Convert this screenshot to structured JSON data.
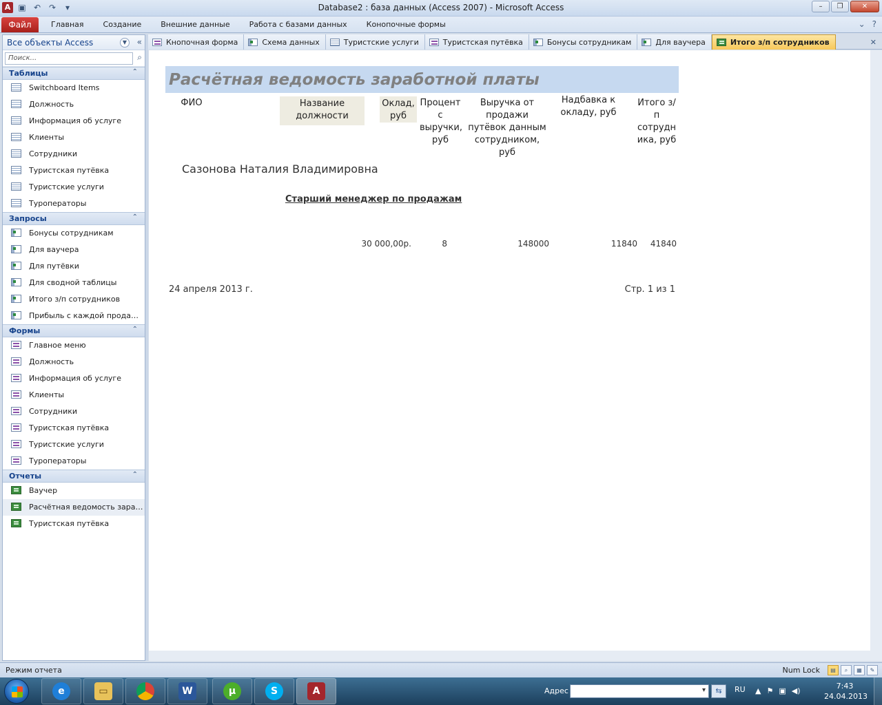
{
  "window": {
    "title": "Database2 : база данных (Access 2007)  -  Microsoft Access",
    "app_icon": "A"
  },
  "ribbon": {
    "file_tab": "Файл",
    "tabs": [
      "Главная",
      "Создание",
      "Внешние данные",
      "Работа с базами данных",
      "Конопочные формы"
    ]
  },
  "nav": {
    "title": "Все объекты Access",
    "search_placeholder": "Поиск...",
    "groups": [
      {
        "title": "Таблицы",
        "items": [
          "Switchboard Items",
          "Должность",
          "Информация об услуге",
          "Клиенты",
          "Сотрудники",
          "Туристская путёвка",
          "Туристские услуги",
          "Туроператоры"
        ]
      },
      {
        "title": "Запросы",
        "items": [
          "Бонусы сотрудникам",
          "Для ваучера",
          "Для путёвки",
          "Для сводной таблицы",
          "Итого з/п сотрудников",
          "Прибыль с каждой проданн..."
        ]
      },
      {
        "title": "Формы",
        "items": [
          "Главное меню",
          "Должность",
          "Информация об услуге",
          "Клиенты",
          "Сотрудники",
          "Туристская путёвка",
          "Туристские услуги",
          "Туроператоры"
        ]
      },
      {
        "title": "Отчеты",
        "items": [
          "Ваучер",
          "Расчётная ведомость зараб...",
          "Туристская путёвка"
        ]
      }
    ]
  },
  "doc_tabs": [
    "Кнопочная форма",
    "Схема данных",
    "Туристские услуги",
    "Туристская путёвка",
    "Бонусы сотрудникам",
    "Для ваучера",
    "Итого з/п сотрудников"
  ],
  "report": {
    "title": "Расчётная ведомость заработной платы",
    "headers": {
      "fio": "ФИО",
      "position": "Название должности",
      "salary": "Оклад, руб",
      "percent": "Процент с выручки, руб",
      "revenue": "Выручка от продажи путёвок данным сотрудником, руб",
      "bonus": "Надбавка к окладу, руб",
      "total": "Итого з/п сотрудн ика, руб"
    },
    "employee_name": "Сазонова Наталия Владимировна",
    "position_name": "Старший менеджер по продажам",
    "values": {
      "salary": "30 000,00р.",
      "percent": "8",
      "revenue": "148000",
      "bonus": "11840",
      "total": "41840"
    },
    "footer_date": "24 апреля 2013 г.",
    "footer_page": "Стр. 1 из 1"
  },
  "status": {
    "mode": "Режим отчета",
    "numlock": "Num Lock"
  },
  "taskbar": {
    "address_label": "Адрес",
    "lang": "RU",
    "time": "7:43",
    "date": "24.04.2013",
    "apps": [
      "internet-explorer",
      "file-explorer",
      "chrome",
      "word",
      "utorrent",
      "skype",
      "access"
    ]
  }
}
